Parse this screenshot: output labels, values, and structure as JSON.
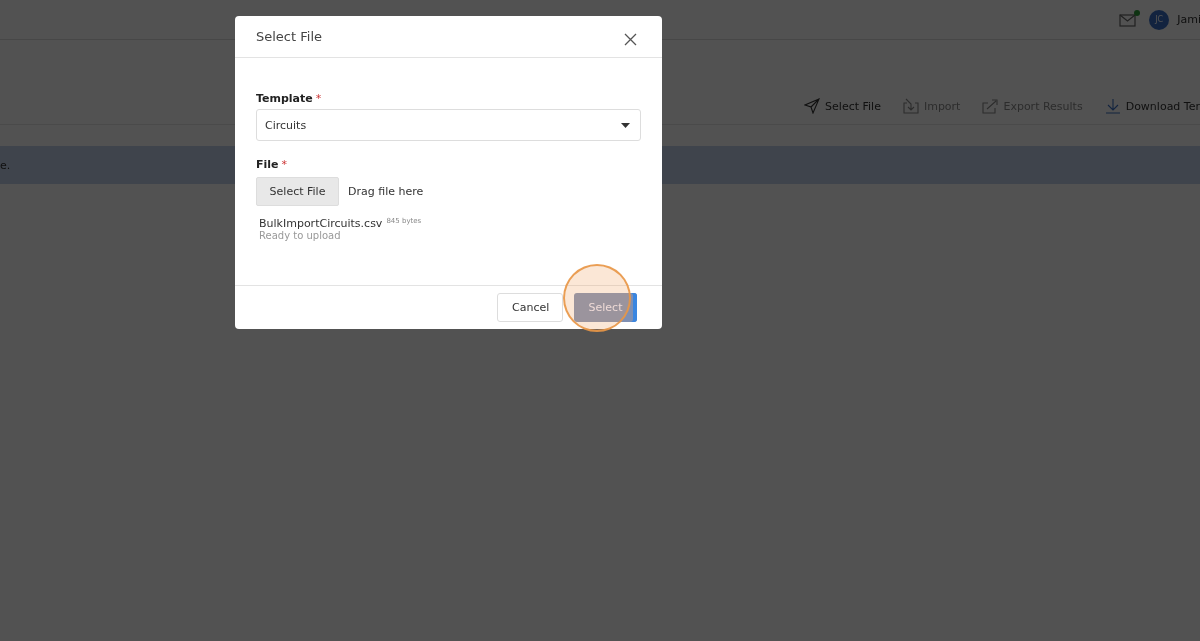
{
  "header": {
    "notification": {
      "unread": true
    },
    "user": {
      "initials": "JC",
      "name": "Jami"
    }
  },
  "toolbar": [
    {
      "label": "Select File",
      "disabled": false
    },
    {
      "label": "Import",
      "disabled": true
    },
    {
      "label": "Export Results",
      "disabled": true
    },
    {
      "label": "Download Ter",
      "disabled": false
    }
  ],
  "banner": {
    "text": "e."
  },
  "dialog": {
    "title": "Select File",
    "template": {
      "label": "Template",
      "required_mark": "*",
      "value": "Circuits"
    },
    "file": {
      "label": "File",
      "required_mark": "*",
      "button": "Select File",
      "drop_hint": "Drag file here",
      "name": "BulkImportCircuits.csv",
      "size": "845 bytes",
      "status": "Ready to upload"
    },
    "buttons": [
      {
        "label": "Cancel",
        "kind": "secondary",
        "highlighted": false
      },
      {
        "label": "Select",
        "kind": "primary",
        "highlighted": true
      }
    ]
  }
}
